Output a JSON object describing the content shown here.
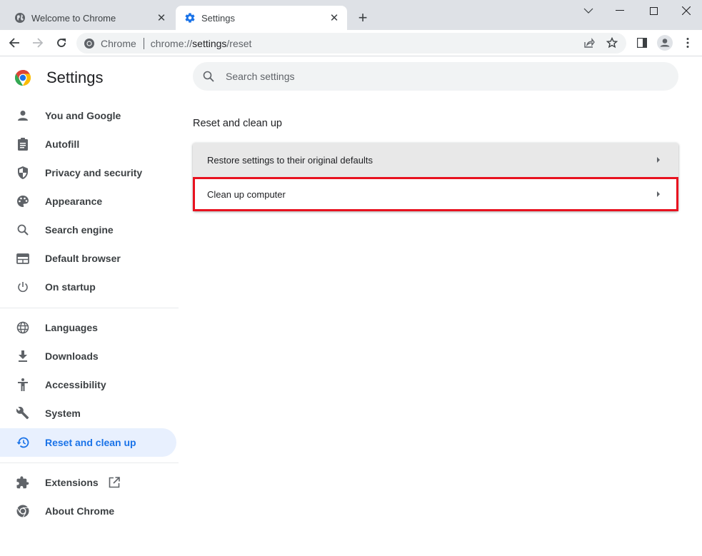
{
  "browser": {
    "tabs": [
      {
        "title": "Welcome to Chrome",
        "icon": "globe-icon",
        "active": false
      },
      {
        "title": "Settings",
        "icon": "gear-icon",
        "active": true
      }
    ],
    "new_tab_label": "+",
    "omnibox": {
      "chip": "Chrome",
      "url_prefix": "chrome://",
      "url_host": "settings",
      "url_path": "/reset"
    }
  },
  "settings": {
    "title": "Settings",
    "search_placeholder": "Search settings",
    "nav": {
      "group1": [
        {
          "label": "You and Google",
          "icon": "person-icon"
        },
        {
          "label": "Autofill",
          "icon": "clipboard-icon"
        },
        {
          "label": "Privacy and security",
          "icon": "shield-icon"
        },
        {
          "label": "Appearance",
          "icon": "palette-icon"
        },
        {
          "label": "Search engine",
          "icon": "search-icon"
        },
        {
          "label": "Default browser",
          "icon": "browser-window-icon"
        },
        {
          "label": "On startup",
          "icon": "power-icon"
        }
      ],
      "group2": [
        {
          "label": "Languages",
          "icon": "globe-icon"
        },
        {
          "label": "Downloads",
          "icon": "download-icon"
        },
        {
          "label": "Accessibility",
          "icon": "accessibility-icon"
        },
        {
          "label": "System",
          "icon": "wrench-icon"
        },
        {
          "label": "Reset and clean up",
          "icon": "history-icon",
          "selected": true
        }
      ],
      "group3": [
        {
          "label": "Extensions",
          "icon": "puzzle-icon"
        },
        {
          "label": "About Chrome",
          "icon": "chrome-icon"
        }
      ]
    },
    "section": {
      "title": "Reset and clean up",
      "rows": [
        {
          "label": "Restore settings to their original defaults"
        },
        {
          "label": "Clean up computer"
        }
      ]
    }
  },
  "colors": {
    "accent": "#1a73e8",
    "selected_bg": "#e8f0fe",
    "highlight_border": "#e8121f"
  }
}
